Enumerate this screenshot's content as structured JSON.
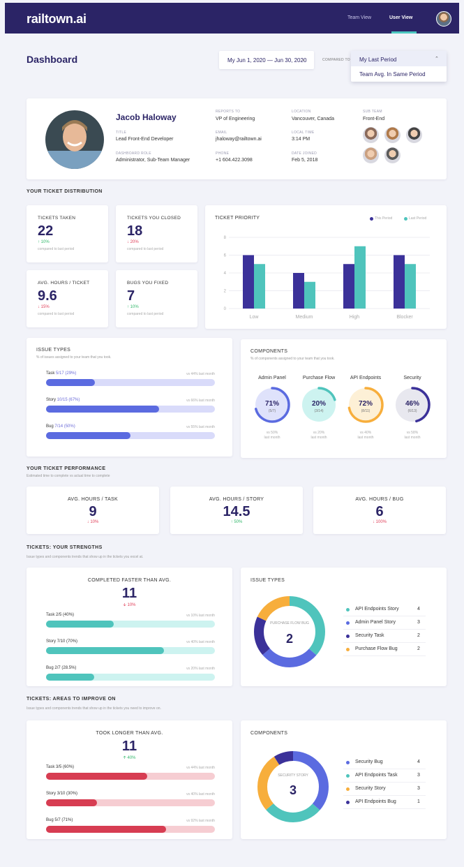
{
  "nav": {
    "logo": "railtown.ai",
    "team_view": "Team View",
    "user_view": "User View"
  },
  "header": {
    "title": "Dashboard",
    "date_range": "My Jun 1, 2020 — Jun 30, 2020",
    "compared_to": "COMPARED TO",
    "compare_selected": "My Last Period",
    "compare_option": "Team Avg. In Same Period"
  },
  "profile": {
    "name": "Jacob Haloway",
    "title_label": "TITLE",
    "title": "Lead Front-End Developer",
    "role_label": "DASHBOARD ROLE",
    "role": "Administrator, Sub-Team Manager",
    "reports_label": "REPORTS TO",
    "reports": "VP of Engineering",
    "email_label": "EMAIL",
    "email": "jhaloway@railtown.ai",
    "phone_label": "PHONE",
    "phone": "+1 604.422.3098",
    "location_label": "LOCATION",
    "location": "Vancouver, Canada",
    "time_label": "LOCAL TIME",
    "time": "3:14 PM",
    "joined_label": "DATE JOINED",
    "joined": "Feb 5, 2018",
    "subteam_label": "SUB TEAM",
    "subteam": "Front-End"
  },
  "distribution": {
    "heading": "YOUR TICKET DISTRIBUTION",
    "compare_text": "compared to last period",
    "stats": [
      {
        "title": "TICKETS TAKEN",
        "value": "22",
        "change": "10%",
        "dir": "up"
      },
      {
        "title": "TICKETS YOU CLOSED",
        "value": "18",
        "change": "20%",
        "dir": "down"
      },
      {
        "title": "AVG. HOURS / TICKET",
        "value": "9.6",
        "change": "15%",
        "dir": "down"
      },
      {
        "title": "BUGS YOU FIXED",
        "value": "7",
        "change": "10%",
        "dir": "up"
      }
    ]
  },
  "chart_data": {
    "type": "bar",
    "title": "TICKET PRIORITY",
    "categories": [
      "Low",
      "Medium",
      "High",
      "Blocker"
    ],
    "series": [
      {
        "name": "This Period",
        "values": [
          6,
          4,
          5,
          6
        ],
        "color": "#3b3199"
      },
      {
        "name": "Last Period",
        "values": [
          5,
          3,
          7,
          5
        ],
        "color": "#4fc4bc"
      }
    ],
    "yticks": [
      "0",
      "2",
      "4",
      "6",
      "8"
    ],
    "ylim": [
      0,
      8
    ],
    "grid": true,
    "legend": "top-right"
  },
  "issue_types": {
    "title": "ISSUE TYPES",
    "subtitle": "% of issues assigned to your team that you took.",
    "rows": [
      {
        "name": "Task",
        "value": "5/17 (29%)",
        "pct": 0.29,
        "vs": "vs 44% last month"
      },
      {
        "name": "Story",
        "value": "10/15 (67%)",
        "pct": 0.67,
        "vs": "vs 66% last month"
      },
      {
        "name": "Bug",
        "value": "7/14 (50%)",
        "pct": 0.5,
        "vs": "vs 55% last month"
      }
    ]
  },
  "components": {
    "title": "COMPONENTS",
    "subtitle": "% of components assigned to your team that you took.",
    "items": [
      {
        "name": "Admin Panel",
        "pct_text": "71%",
        "frac": "(5/7)",
        "pct": 0.71,
        "vs": "vs 50%",
        "vs2": "last month",
        "color": "#5b6be0",
        "bg": "#dfe2fb"
      },
      {
        "name": "Purchase Flow",
        "pct_text": "20%",
        "frac": "(3/14)",
        "pct": 0.2,
        "vs": "vs 20%",
        "vs2": "last month",
        "color": "#4fc4bc",
        "bg": "#cdf3f0"
      },
      {
        "name": "API Endpoints",
        "pct_text": "72%",
        "frac": "(8/11)",
        "pct": 0.72,
        "vs": "vs 40%",
        "vs2": "last month",
        "color": "#f7ae3c",
        "bg": "#fdf0d6"
      },
      {
        "name": "Security",
        "pct_text": "46%",
        "frac": "(6/13)",
        "pct": 0.46,
        "vs": "vs 58%",
        "vs2": "last month",
        "color": "#3b3199",
        "bg": "#e8e8ef"
      }
    ]
  },
  "performance": {
    "heading": "YOUR TICKET PERFORMANCE",
    "sub": "Estimated time to complete vs actual time to complete",
    "stats": [
      {
        "title": "AVG. HOURS / TASK",
        "value": "9",
        "change": "10%",
        "dir": "down"
      },
      {
        "title": "AVG. HOURS / STORY",
        "value": "14.5",
        "change": "50%",
        "dir": "up"
      },
      {
        "title": "AVG. HOURS / BUG",
        "value": "6",
        "change": "100%",
        "dir": "down"
      }
    ]
  },
  "strengths": {
    "heading": "TICKETS: YOUR STRENGTHS",
    "sub": "Issue types and components trends that show up in the tickets you excel at.",
    "card_title": "COMPLETED FASTER THAN AVG.",
    "value": "11",
    "change": "10%",
    "rows": [
      {
        "name": "Task",
        "value": "2/5 (40%)",
        "pct": 0.4,
        "vs": "vs 10% last month"
      },
      {
        "name": "Story",
        "value": "7/10 (70%)",
        "pct": 0.7,
        "vs": "vs 40% last month"
      },
      {
        "name": "Bug",
        "value": "2/7 (28.5%)",
        "pct": 0.285,
        "vs": "vs 20% last month"
      }
    ],
    "donut_title": "ISSUE TYPES",
    "donut_center_label": "PURCHASE FLOW BUG",
    "donut_center_value": "2",
    "legend": [
      {
        "name": "API Endpoints Story",
        "count": "4",
        "color": "#4fc4bc"
      },
      {
        "name": "Admin Panel Story",
        "count": "3",
        "color": "#5b6be0"
      },
      {
        "name": "Security Task",
        "count": "2",
        "color": "#3b3199"
      },
      {
        "name": "Purchase Flow Bug",
        "count": "2",
        "color": "#f7ae3c"
      }
    ]
  },
  "improve": {
    "heading": "TICKETS: AREAS TO IMPROVE ON",
    "sub": "Issue types and components trends that show up in the tickets you need to improve on.",
    "card_title": "TOOK LONGER THAN AVG.",
    "value": "11",
    "change": "40%",
    "rows": [
      {
        "name": "Task",
        "value": "3/5 (60%)",
        "pct": 0.6,
        "vs": "vs 44% last month"
      },
      {
        "name": "Story",
        "value": "3/10 (30%)",
        "pct": 0.3,
        "vs": "vs 40% last month"
      },
      {
        "name": "Bug",
        "value": "5/7 (71%)",
        "pct": 0.71,
        "vs": "vs 92% last month"
      }
    ],
    "donut_title": "COMPONENTS",
    "donut_center_label": "SECURITY STORY",
    "donut_center_value": "3",
    "legend": [
      {
        "name": "Security Bug",
        "count": "4",
        "color": "#5b6be0"
      },
      {
        "name": "API Endpoints Task",
        "count": "3",
        "color": "#4fc4bc"
      },
      {
        "name": "Security Story",
        "count": "3",
        "color": "#f7ae3c"
      },
      {
        "name": "API Endpoints Bug",
        "count": "1",
        "color": "#3b3199"
      }
    ]
  }
}
